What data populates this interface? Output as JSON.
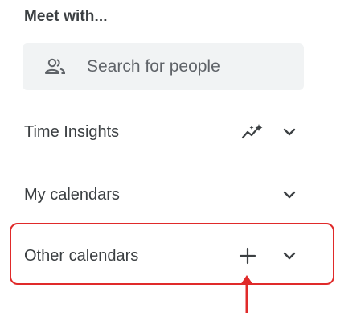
{
  "meet_with": {
    "title": "Meet with...",
    "search": {
      "placeholder": "Search for people",
      "icon": "people-icon"
    }
  },
  "sections": {
    "time_insights": {
      "label": "Time Insights",
      "icons": [
        "insights-sparkle-icon",
        "chevron-down-icon"
      ]
    },
    "my_calendars": {
      "label": "My calendars",
      "icons": [
        "chevron-down-icon"
      ]
    },
    "other_calendars": {
      "label": "Other calendars",
      "icons": [
        "plus-icon",
        "chevron-down-icon"
      ]
    }
  },
  "annotation": {
    "highlight_color": "#e02a2a",
    "target": "other-calendars-add-button"
  },
  "colors": {
    "text": "#3c4043",
    "secondary_text": "#5f6368",
    "search_bg": "#f1f3f4"
  }
}
